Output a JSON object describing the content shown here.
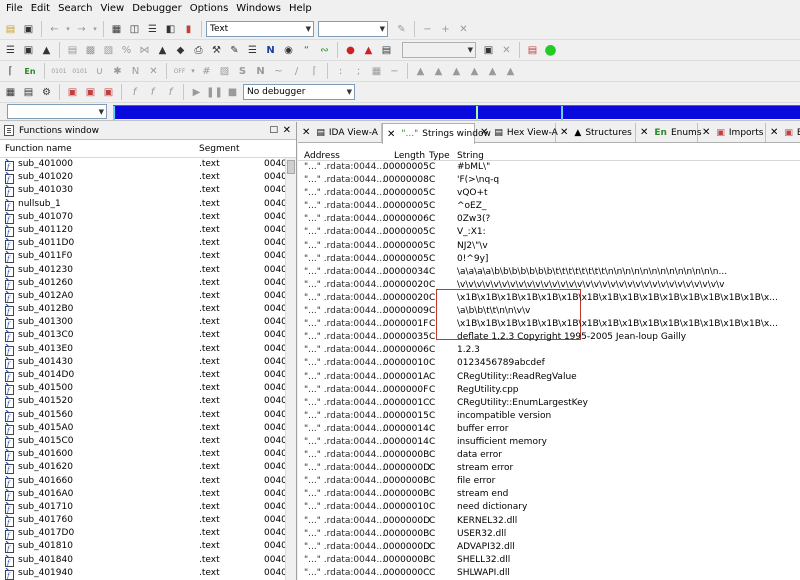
{
  "menubar": {
    "items": [
      "File",
      "Edit",
      "Search",
      "View",
      "Debugger",
      "Options",
      "Windows",
      "Help"
    ]
  },
  "toolbar": {
    "text_combo": "Text",
    "debugger_combo": "No debugger"
  },
  "functions_window": {
    "title": "Functions window",
    "columns": [
      "Function name",
      "Segment"
    ],
    "rows": [
      {
        "name": "sub_401000",
        "segment": ".text",
        "start": "0040"
      },
      {
        "name": "sub_401020",
        "segment": ".text",
        "start": "0040"
      },
      {
        "name": "sub_401030",
        "segment": ".text",
        "start": "0040"
      },
      {
        "name": "nullsub_1",
        "segment": ".text",
        "start": "0040"
      },
      {
        "name": "sub_401070",
        "segment": ".text",
        "start": "0040"
      },
      {
        "name": "sub_401120",
        "segment": ".text",
        "start": "0040"
      },
      {
        "name": "sub_4011D0",
        "segment": ".text",
        "start": "0040"
      },
      {
        "name": "sub_4011F0",
        "segment": ".text",
        "start": "0040"
      },
      {
        "name": "sub_401230",
        "segment": ".text",
        "start": "0040"
      },
      {
        "name": "sub_401260",
        "segment": ".text",
        "start": "0040"
      },
      {
        "name": "sub_4012A0",
        "segment": ".text",
        "start": "0040"
      },
      {
        "name": "sub_4012B0",
        "segment": ".text",
        "start": "0040"
      },
      {
        "name": "sub_401300",
        "segment": ".text",
        "start": "0040"
      },
      {
        "name": "sub_4013C0",
        "segment": ".text",
        "start": "0040"
      },
      {
        "name": "sub_4013E0",
        "segment": ".text",
        "start": "0040"
      },
      {
        "name": "sub_401430",
        "segment": ".text",
        "start": "0040"
      },
      {
        "name": "sub_4014D0",
        "segment": ".text",
        "start": "0040"
      },
      {
        "name": "sub_401500",
        "segment": ".text",
        "start": "0040"
      },
      {
        "name": "sub_401520",
        "segment": ".text",
        "start": "0040"
      },
      {
        "name": "sub_401560",
        "segment": ".text",
        "start": "0040"
      },
      {
        "name": "sub_4015A0",
        "segment": ".text",
        "start": "0040"
      },
      {
        "name": "sub_4015C0",
        "segment": ".text",
        "start": "0040"
      },
      {
        "name": "sub_401600",
        "segment": ".text",
        "start": "0040"
      },
      {
        "name": "sub_401620",
        "segment": ".text",
        "start": "0040"
      },
      {
        "name": "sub_401660",
        "segment": ".text",
        "start": "0040"
      },
      {
        "name": "sub_4016A0",
        "segment": ".text",
        "start": "0040"
      },
      {
        "name": "sub_401710",
        "segment": ".text",
        "start": "0040"
      },
      {
        "name": "sub_401760",
        "segment": ".text",
        "start": "0040"
      },
      {
        "name": "sub_4017D0",
        "segment": ".text",
        "start": "0040"
      },
      {
        "name": "sub_401810",
        "segment": ".text",
        "start": "0040"
      },
      {
        "name": "sub_401840",
        "segment": ".text",
        "start": "0040"
      },
      {
        "name": "sub_401940",
        "segment": ".text",
        "start": "0040"
      }
    ]
  },
  "tabs": [
    {
      "label": "IDA View-A",
      "icon": "ida-view-icon"
    },
    {
      "label": "Strings window",
      "icon": "strings-icon"
    },
    {
      "label": "Hex View-A",
      "icon": "hex-view-icon"
    },
    {
      "label": "Structures",
      "icon": "structures-icon"
    },
    {
      "label": "Enums",
      "icon": "enums-icon"
    },
    {
      "label": "Imports",
      "icon": "imports-icon"
    },
    {
      "label": "E",
      "icon": "exports-icon"
    }
  ],
  "strings_window": {
    "columns": [
      "Address",
      "Length",
      "Type",
      "String"
    ],
    "rows": [
      {
        "address": "\"...\" .rdata:0044...",
        "length": "00000005",
        "type": "C",
        "string": "#bML\\\""
      },
      {
        "address": "\"...\" .rdata:0044...",
        "length": "00000008",
        "type": "C",
        "string": "'F(>\\nq-q"
      },
      {
        "address": "\"...\" .rdata:0044...",
        "length": "00000005",
        "type": "C",
        "string": "vQO+t"
      },
      {
        "address": "\"...\" .rdata:0044...",
        "length": "00000005",
        "type": "C",
        "string": "^oEZ_"
      },
      {
        "address": "\"...\" .rdata:0044...",
        "length": "00000006",
        "type": "C",
        "string": "0Zw3(?"
      },
      {
        "address": "\"...\" .rdata:0044...",
        "length": "00000005",
        "type": "C",
        "string": "V_:X1:"
      },
      {
        "address": "\"...\" .rdata:0044...",
        "length": "00000005",
        "type": "C",
        "string": "NJ2\\\"\\v"
      },
      {
        "address": "\"...\" .rdata:0044...",
        "length": "00000005",
        "type": "C",
        "string": "0!^9y]"
      },
      {
        "address": "\"...\" .rdata:0044...",
        "length": "00000034",
        "type": "C",
        "string": "\\a\\a\\a\\a\\b\\b\\b\\b\\b\\b\\b\\t\\t\\t\\t\\t\\t\\t\\t\\n\\n\\n\\n\\n\\n\\n\\n\\n\\n\\n\\n\\n..."
      },
      {
        "address": "\"...\" .rdata:0044...",
        "length": "00000020",
        "type": "C",
        "string": "\\v\\v\\v\\v\\v\\v\\v\\v\\v\\v\\v\\v\\v\\v\\v\\v\\v\\v\\v\\v\\v\\v\\v\\v\\v\\v\\v\\v\\v\\v\\v\\v"
      },
      {
        "address": "\"...\" .rdata:0044...",
        "length": "00000020",
        "type": "C",
        "string": "\\x1B\\x1B\\x1B\\x1B\\x1B\\x1B\\x1B\\x1B\\x1B\\x1B\\x1B\\x1B\\x1B\\x1B\\x1B\\x..."
      },
      {
        "address": "\"...\" .rdata:0044...",
        "length": "00000009",
        "type": "C",
        "string": "\\a\\b\\b\\t\\t\\n\\n\\v\\v"
      },
      {
        "address": "\"...\" .rdata:0044...",
        "length": "0000001F",
        "type": "C",
        "string": "\\x1B\\x1B\\x1B\\x1B\\x1B\\x1B\\x1B\\x1B\\x1B\\x1B\\x1B\\x1B\\x1B\\x1B\\x1B\\x..."
      },
      {
        "address": "\"...\" .rdata:0044...",
        "length": "00000035",
        "type": "C",
        "string": " deflate 1.2.3 Copyright 1995-2005 Jean-loup Gailly "
      },
      {
        "address": "\"...\" .rdata:0044...",
        "length": "00000006",
        "type": "C",
        "string": "1.2.3"
      },
      {
        "address": "\"...\" .rdata:0044...",
        "length": "00000010",
        "type": "C",
        "string": "0123456789abcdef"
      },
      {
        "address": "\"...\" .rdata:0044...",
        "length": "0000001A",
        "type": "C",
        "string": "CRegUtility::ReadRegValue"
      },
      {
        "address": "\"...\" .rdata:0044...",
        "length": "0000000F",
        "type": "C",
        "string": "RegUtility.cpp"
      },
      {
        "address": "\"...\" .rdata:0044...",
        "length": "0000001C",
        "type": "C",
        "string": "CRegUtility::EnumLargestKey"
      },
      {
        "address": "\"...\" .rdata:0044...",
        "length": "00000015",
        "type": "C",
        "string": "incompatible version"
      },
      {
        "address": "\"...\" .rdata:0044...",
        "length": "00000014",
        "type": "C",
        "string": "buffer error"
      },
      {
        "address": "\"...\" .rdata:0044...",
        "length": "00000014",
        "type": "C",
        "string": "insufficient memory"
      },
      {
        "address": "\"...\" .rdata:0044...",
        "length": "0000000B",
        "type": "C",
        "string": "data error"
      },
      {
        "address": "\"...\" .rdata:0044...",
        "length": "0000000D",
        "type": "C",
        "string": "stream error"
      },
      {
        "address": "\"...\" .rdata:0044...",
        "length": "0000000B",
        "type": "C",
        "string": "file error"
      },
      {
        "address": "\"...\" .rdata:0044...",
        "length": "0000000B",
        "type": "C",
        "string": "stream end"
      },
      {
        "address": "\"...\" .rdata:0044...",
        "length": "00000010",
        "type": "C",
        "string": "need dictionary"
      },
      {
        "address": "\"...\" .rdata:0044...",
        "length": "0000000D",
        "type": "C",
        "string": "KERNEL32.dll"
      },
      {
        "address": "\"...\" .rdata:0044...",
        "length": "0000000B",
        "type": "C",
        "string": "USER32.dll"
      },
      {
        "address": "\"...\" .rdata:0044...",
        "length": "0000000D",
        "type": "C",
        "string": "ADVAPI32.dll"
      },
      {
        "address": "\"...\" .rdata:0044...",
        "length": "0000000B",
        "type": "C",
        "string": "SHELL32.dll"
      },
      {
        "address": "\"...\" .rdata:0044...",
        "length": "0000000C",
        "type": "C",
        "string": "SHLWAPI.dll"
      }
    ]
  },
  "colors": {
    "nav_strip": "#0a0adc",
    "highlight_box": "#c0392b",
    "function_icon_accent": "#1f4fb4"
  }
}
